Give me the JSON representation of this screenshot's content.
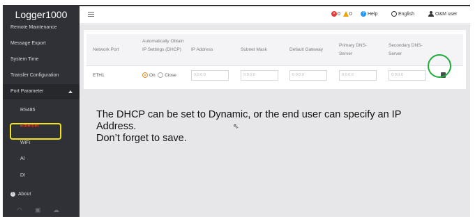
{
  "app": {
    "title": "Logger1000"
  },
  "sidebar": {
    "items": [
      {
        "label": "Remote Maintenance"
      },
      {
        "label": "Message Export"
      },
      {
        "label": "System Time"
      },
      {
        "label": "Transfer Configuration"
      },
      {
        "label": "Port Parameter"
      },
      {
        "label": "RS485"
      },
      {
        "label": "Ethernet"
      },
      {
        "label": "WiFi"
      },
      {
        "label": "AI"
      },
      {
        "label": "DI"
      },
      {
        "label": "About"
      }
    ],
    "bottom_icons": [
      "wifi-icon",
      "device-icon",
      "cloud-icon"
    ]
  },
  "header": {
    "menu_icon": "menu-icon",
    "errors": "0",
    "warnings": "0",
    "help": "Help",
    "language": "English",
    "user": "O&M user"
  },
  "table": {
    "headers": [
      "Network Port",
      "Automatically Obtain IP Settings (DHCP)",
      "IP Address",
      "Subnet Mask",
      "Default Gateway",
      "Primary DNS-Server",
      "Secondary DNS-Server"
    ],
    "row": {
      "port": "ETH1",
      "dhcp_on": "On",
      "dhcp_close": "Close",
      "dhcp_selected": "On",
      "ip": "0.0.0.0",
      "subnet": "0.0.0.0",
      "gateway": "0.0.0.0",
      "dns1": "0.0.0.0",
      "dns2": "0.0.0.0"
    }
  },
  "annotation": {
    "line1": "The DHCP can be set to Dynamic, or the end user can specify an IP",
    "line2": "Address.",
    "line3": "Don’t forget to save."
  },
  "colors": {
    "sidebar_bg": "#2f3136",
    "accent_orange": "#f08a24",
    "active_item": "#e8453c",
    "highlight_yellow": "#f2e31a",
    "highlight_green": "#1dab3a"
  }
}
